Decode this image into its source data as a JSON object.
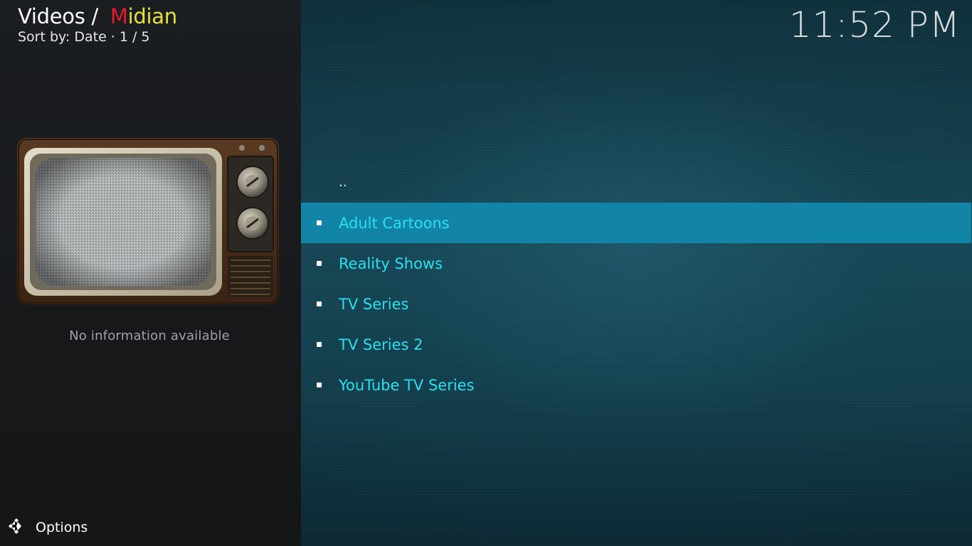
{
  "header": {
    "section": "Videos /",
    "addon_first_letter": "M",
    "addon_rest": "idian",
    "sort_label": "Sort by: Date",
    "separator": "·",
    "page_count": "1 / 5"
  },
  "clock": {
    "time": "11:52 PM"
  },
  "info": {
    "no_info_text": "No information available"
  },
  "footer": {
    "options_label": "Options"
  },
  "list": {
    "parent_label": "..",
    "items": [
      {
        "label": "Adult Cartoons",
        "selected": true
      },
      {
        "label": "Reality Shows",
        "selected": false
      },
      {
        "label": "TV Series",
        "selected": false
      },
      {
        "label": "TV Series 2",
        "selected": false
      },
      {
        "label": "YouTube TV Series",
        "selected": false
      }
    ]
  },
  "colors": {
    "addon_red": "#e8192c",
    "addon_yellow": "#e9e13a",
    "item_text": "#28e0f0",
    "selected_bg": "#1284a6"
  },
  "icons": {
    "options": "options-icon",
    "tv_thumbnail": "retro-tv-icon",
    "bullet": "bullet-icon"
  }
}
